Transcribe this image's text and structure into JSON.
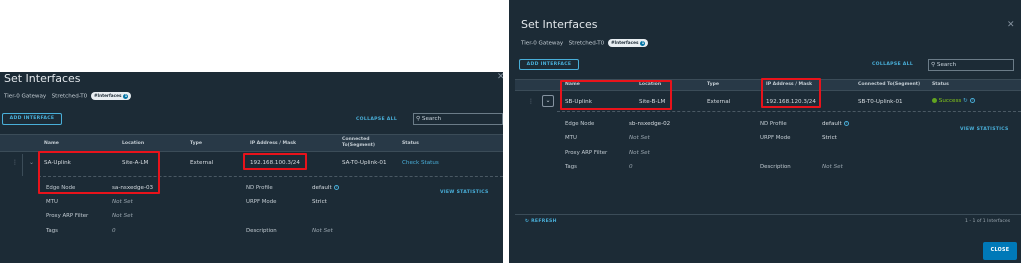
{
  "left": {
    "title": "Set Interfaces",
    "breadcrumb": {
      "gateway_label": "Tier-0 Gateway",
      "gateway_value": "Stretched-T0",
      "pill_label": "#Interfaces",
      "pill_count": "1"
    },
    "add_interface": "ADD INTERFACE",
    "collapse_all": "COLLAPSE ALL",
    "search_placeholder": "Search",
    "columns": {
      "name": "Name",
      "location": "Location",
      "type": "Type",
      "ip": "IP Address / Mask",
      "connected": "Connected To(Segment)",
      "status": "Status"
    },
    "row": {
      "name": "SA-Uplink",
      "location": "Site-A-LM",
      "type": "External",
      "ip": "192.168.100.3/24",
      "connected": "SA-T0-Uplink-01",
      "status": "Check Status"
    },
    "details": {
      "edge_node_label": "Edge Node",
      "edge_node_value": "sa-nsxedge-03",
      "mtu_label": "MTU",
      "mtu_value": "Not Set",
      "proxy_arp_label": "Proxy ARP Filter",
      "proxy_arp_value": "Not Set",
      "tags_label": "Tags",
      "tags_value": "0",
      "nd_profile_label": "ND Profile",
      "nd_profile_value": "default",
      "urpf_label": "URPF Mode",
      "urpf_value": "Strict",
      "description_label": "Description",
      "description_value": "Not Set",
      "view_statistics": "VIEW STATISTICS"
    }
  },
  "right": {
    "title": "Set Interfaces",
    "breadcrumb": {
      "gateway_label": "Tier-0 Gateway",
      "gateway_value": "Stretched-T0",
      "pill_label": "#Interfaces",
      "pill_count": "1"
    },
    "add_interface": "ADD INTERFACE",
    "collapse_all": "COLLAPSE ALL",
    "search_placeholder": "Search",
    "columns": {
      "name": "Name",
      "location": "Location",
      "type": "Type",
      "ip": "IP Address / Mask",
      "connected": "Connected To(Segment)",
      "status": "Status"
    },
    "row": {
      "name": "SB-Uplink",
      "location": "Site-B-LM",
      "type": "External",
      "ip": "192.168.120.3/24",
      "connected": "SB-T0-Uplink-01",
      "status": "Success"
    },
    "details": {
      "edge_node_label": "Edge Node",
      "edge_node_value": "sb-nsxedge-02",
      "mtu_label": "MTU",
      "mtu_value": "Not Set",
      "proxy_arp_label": "Proxy ARP Filter",
      "proxy_arp_value": "Not Set",
      "tags_label": "Tags",
      "tags_value": "0",
      "nd_profile_label": "ND Profile",
      "nd_profile_value": "default",
      "urpf_label": "URPF Mode",
      "urpf_value": "Strict",
      "description_label": "Description",
      "description_value": "Not Set",
      "view_statistics": "VIEW STATISTICS"
    },
    "refresh": "REFRESH",
    "pagination": "1 - 1 of 1 Interfaces",
    "close_button": "CLOSE"
  },
  "colors": {
    "dialog_bg": "#1c2b36",
    "accent": "#49afd9",
    "highlight": "#e8131b",
    "success": "#62a420"
  },
  "icons": [
    "close-icon",
    "search-icon",
    "info-icon",
    "refresh-icon",
    "chevron-down-icon",
    "kebab-icon",
    "success-icon"
  ]
}
